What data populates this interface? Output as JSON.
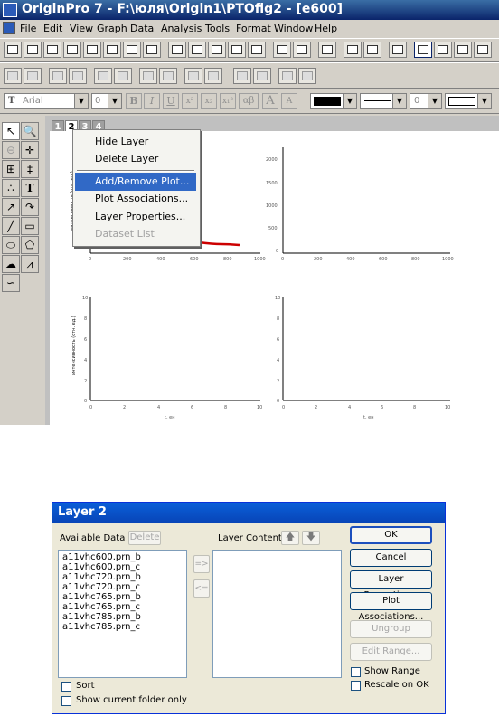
{
  "window": {
    "title": "OriginPro 7 - F:\\юля\\Origin1\\PTOfig2 - [e600]",
    "menu": [
      "File",
      "Edit",
      "View",
      "Graph",
      "Data",
      "Analysis",
      "Tools",
      "Format",
      "Window",
      "Help"
    ]
  },
  "format_bar": {
    "font": "Arial",
    "size": "0",
    "bold": "B",
    "italic": "I",
    "underline": "U",
    "superscript": "x²",
    "subscript": "x₂",
    "supsub": "x₁²",
    "greek": "αβ",
    "increase_font": "A",
    "decrease_font": "A",
    "line_width": "0"
  },
  "layer_tabs": [
    "1",
    "2",
    "3",
    "4"
  ],
  "tool_palette": {
    "text_tool": "T"
  },
  "context_menu": {
    "items": [
      {
        "label": "Hide Layer",
        "state": "normal"
      },
      {
        "label": "Delete Layer",
        "state": "normal"
      },
      {
        "label": "Add/Remove Plot...",
        "state": "highlighted"
      },
      {
        "label": "Plot Associations...",
        "state": "normal"
      },
      {
        "label": "Layer Properties...",
        "state": "normal"
      },
      {
        "label": "Dataset List",
        "state": "disabled"
      }
    ]
  },
  "graph": {
    "top_left": {
      "ylabel": "интенсивность (отн. ед.)",
      "xticks": [
        "0",
        "200",
        "400",
        "600",
        "800",
        "1000"
      ]
    },
    "top_right": {
      "yticks": [
        "2000",
        "1500",
        "1000",
        "500",
        "0"
      ],
      "xticks": [
        "0",
        "200",
        "400",
        "600",
        "800",
        "1000"
      ]
    },
    "bottom_left": {
      "ylabel": "интенсивность (отн. ед.)",
      "yticks": [
        "10",
        "8",
        "6",
        "4",
        "2",
        "0"
      ],
      "xticks": [
        "0",
        "2",
        "4",
        "6",
        "8",
        "10"
      ],
      "xlabel": "t, ен"
    },
    "bottom_right": {
      "yticks": [
        "10",
        "8",
        "6",
        "4",
        "2",
        "0"
      ],
      "xticks": [
        "0",
        "2",
        "4",
        "6",
        "8",
        "10"
      ],
      "xlabel": "t, ен"
    },
    "curve_color": "#cc0000"
  },
  "dialog": {
    "title": "Layer 2",
    "available_label": "Available Data",
    "delete_label": "Delete",
    "contents_label": "Layer Contents",
    "available_items": [
      "a11vhc600.prn_b",
      "a11vhc600.prn_c",
      "a11vhc720.prn_b",
      "a11vhc720.prn_c",
      "a11vhc765.prn_b",
      "a11vhc765.prn_c",
      "a11vhc785.prn_b",
      "a11vhc785.prn_c"
    ],
    "add_arrow": "=>",
    "remove_arrow": "<=",
    "buttons": {
      "ok": "OK",
      "cancel": "Cancel",
      "layer_properties": "Layer Properties...",
      "plot_associations": "Plot Associations...",
      "ungroup": "Ungroup",
      "edit_range": "Edit Range..."
    },
    "show_range": "Show Range",
    "rescale_on_ok": "Rescale on OK",
    "sort": "Sort",
    "show_current_folder": "Show current folder only"
  }
}
